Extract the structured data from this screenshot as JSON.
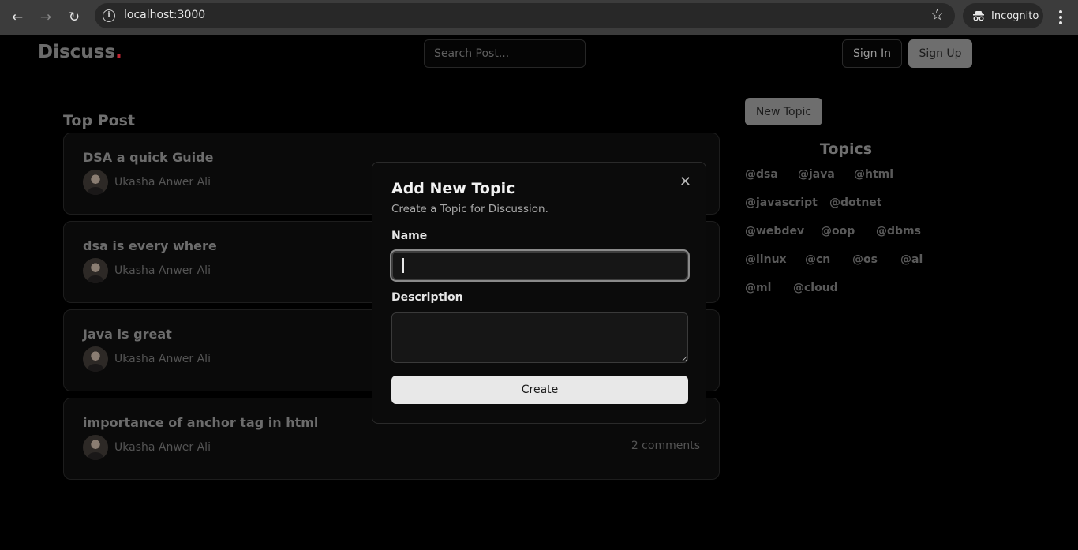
{
  "browser": {
    "url": "localhost:3000",
    "incognito_label": "Incognito"
  },
  "header": {
    "logo_text": "Discuss",
    "logo_dot": ".",
    "search_placeholder": "Search Post...",
    "signin_label": "Sign In",
    "signup_label": "Sign Up"
  },
  "main": {
    "section_title": "Top Post",
    "posts": [
      {
        "title": "DSA a quick Guide",
        "author": "Ukasha Anwer Ali",
        "comments": ""
      },
      {
        "title": "dsa is every where",
        "author": "Ukasha Anwer Ali",
        "comments": ""
      },
      {
        "title": "Java is great",
        "author": "Ukasha Anwer Ali",
        "comments": ""
      },
      {
        "title": "importance of anchor tag in html",
        "author": "Ukasha Anwer Ali",
        "comments": "2 comments"
      }
    ]
  },
  "sidebar": {
    "new_topic_label": "New Topic",
    "topics_title": "Topics",
    "topics": [
      "@dsa",
      "@java",
      "@html",
      "@javascript",
      "@dotnet",
      "@webdev",
      "@oop",
      "@dbms",
      "@linux",
      "@cn",
      "@os",
      "@ai",
      "@ml",
      "@cloud"
    ]
  },
  "modal": {
    "title": "Add New Topic",
    "subtitle": "Create a Topic for Discussion.",
    "name_label": "Name",
    "name_value": "",
    "description_label": "Description",
    "description_value": "",
    "create_label": "Create"
  },
  "colors": {
    "background": "#000000",
    "logo_dot": "#c02633",
    "primary_button": "#6e6e6e",
    "create_button": "#e8e8e8"
  }
}
